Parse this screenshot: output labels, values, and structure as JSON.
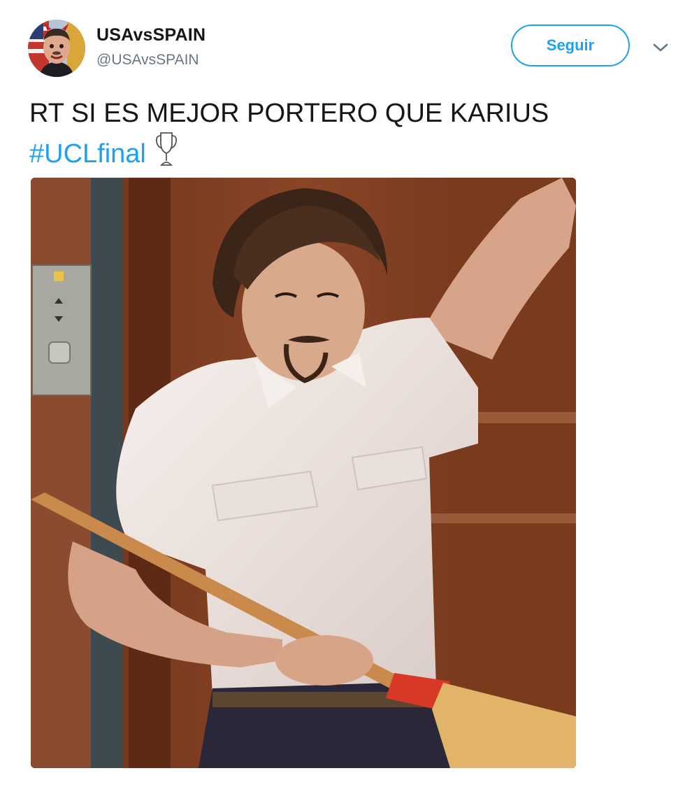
{
  "user": {
    "display_name": "USAvsSPAIN",
    "screen_name": "@USAvsSPAIN"
  },
  "actions": {
    "follow_label": "Seguir",
    "more_icon": "chevron-down-icon"
  },
  "tweet": {
    "text_line1": "RT SI ES MEJOR PORTERO QUE KARIUS",
    "hashtag": "#UCLfinal",
    "emoji_icon": "trophy-icon"
  },
  "colors": {
    "accent": "#1da1f2",
    "text": "#14171a",
    "secondary": "#657786"
  }
}
